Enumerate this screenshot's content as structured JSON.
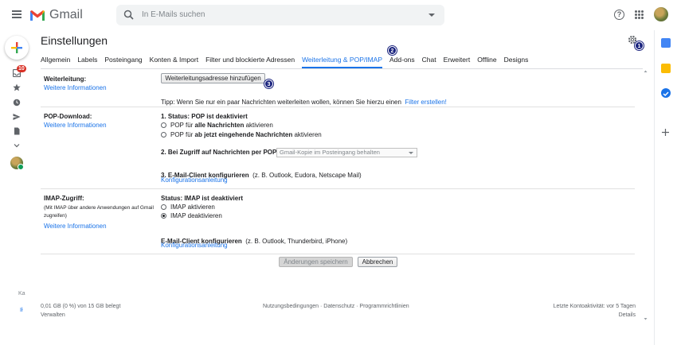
{
  "header": {
    "app_name": "Gmail",
    "search_placeholder": "In E-Mails suchen"
  },
  "left_rail": {
    "inbox_badge": "10",
    "bottom_labels": [
      "Ka",
      "Ił"
    ]
  },
  "page": {
    "title": "Einstellungen"
  },
  "tabs": [
    {
      "label": "Allgemein"
    },
    {
      "label": "Labels"
    },
    {
      "label": "Posteingang"
    },
    {
      "label": "Konten & Import"
    },
    {
      "label": "Filter und blockierte Adressen"
    },
    {
      "label": "Weiterleitung & POP/IMAP",
      "active": true
    },
    {
      "label": "Add-ons"
    },
    {
      "label": "Chat"
    },
    {
      "label": "Erweitert"
    },
    {
      "label": "Offline"
    },
    {
      "label": "Designs"
    }
  ],
  "steps": [
    "1",
    "2",
    "3"
  ],
  "forwarding": {
    "label": "Weiterleitung:",
    "more_info": "Weitere Informationen",
    "add_button": "Weiterleitungsadresse hinzufügen",
    "tip_text": "Tipp: Wenn Sie nur ein paar Nachrichten weiterleiten wollen, können Sie hierzu einen",
    "tip_link": "Filter erstellen!"
  },
  "pop": {
    "label": "POP-Download:",
    "more_info": "Weitere Informationen",
    "status": "1. Status: POP ist deaktiviert",
    "opt1_pre": "POP für",
    "opt1_bold": "alle Nachrichten",
    "opt1_post": "aktivieren",
    "opt2_pre": "POP für",
    "opt2_bold": "ab jetzt eingehende Nachrichten",
    "opt2_post": "aktivieren",
    "access_label": "2. Bei Zugriff auf Nachrichten per POP",
    "access_select": "Gmail-Kopie im Posteingang behalten",
    "client_label": "3. E-Mail-Client konfigurieren",
    "client_hint": "(z. B. Outlook, Eudora, Netscape Mail)",
    "config_link": "Konfigurationsanleitung"
  },
  "imap": {
    "label": "IMAP-Zugriff:",
    "sublabel": "(Mit IMAP über andere Anwendungen auf Gmail zugreifen)",
    "more_info": "Weitere Informationen",
    "status": "Status: IMAP ist deaktiviert",
    "opt_enable": "IMAP aktivieren",
    "opt_disable": "IMAP deaktivieren",
    "client_label": "E-Mail-Client konfigurieren",
    "client_hint": "(z. B. Outlook, Thunderbird, iPhone)",
    "config_link": "Konfigurationsanleitung"
  },
  "actions": {
    "save": "Änderungen speichern",
    "cancel": "Abbrechen"
  },
  "footer": {
    "storage": "0,01 GB (0 %) von 15 GB belegt",
    "manage": "Verwalten",
    "policies": "Nutzungsbedingungen · Datenschutz · Programmrichtlinien",
    "last_activity": "Letzte Kontoaktivität: vor 5 Tagen",
    "details": "Details"
  }
}
